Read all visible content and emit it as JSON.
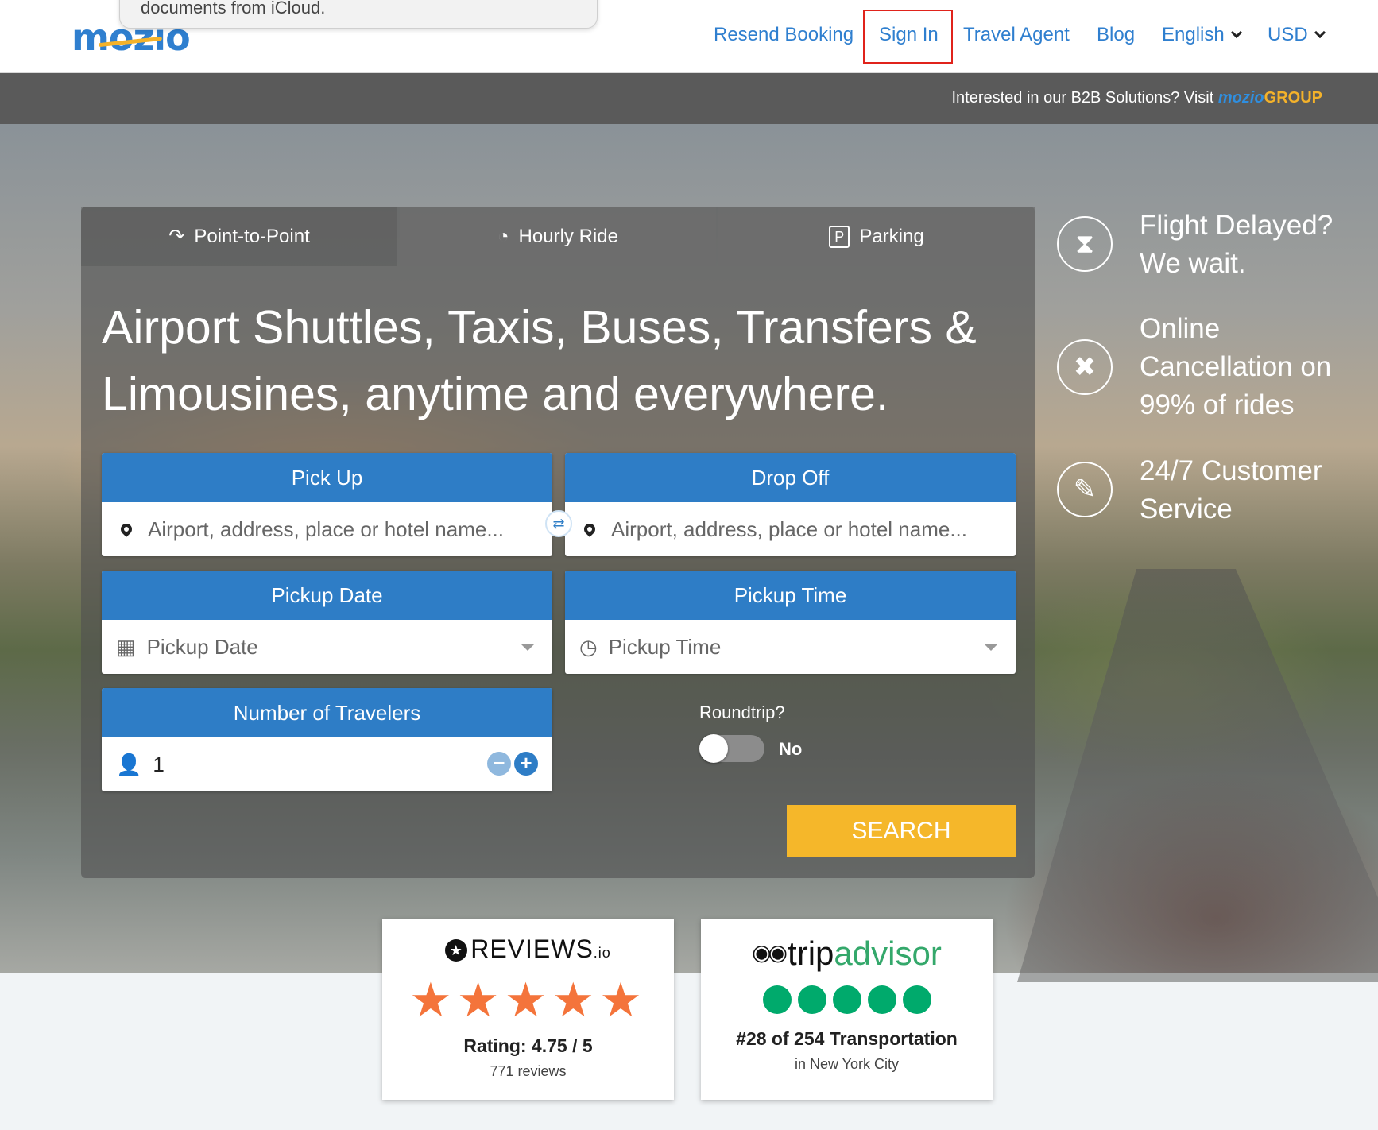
{
  "notification": {
    "text": "documents from iCloud."
  },
  "header": {
    "logo": "mozio",
    "nav": [
      "Resend Booking",
      "Sign In",
      "Travel Agent",
      "Blog"
    ],
    "language": "English",
    "currency": "USD"
  },
  "b2b": {
    "text": "Interested in our B2B Solutions? Visit ",
    "brand": "mozio",
    "group": "GROUP"
  },
  "tabs": [
    "Point-to-Point",
    "Hourly Ride",
    "Parking"
  ],
  "headline": "Airport Shuttles, Taxis, Buses, Transfers & Limousines, anytime and everywhere.",
  "form": {
    "pickup": {
      "label": "Pick Up",
      "placeholder": "Airport, address, place or hotel name..."
    },
    "dropoff": {
      "label": "Drop Off",
      "placeholder": "Airport, address, place or hotel name..."
    },
    "pickup_date": {
      "label": "Pickup Date",
      "placeholder": "Pickup Date"
    },
    "pickup_time": {
      "label": "Pickup Time",
      "placeholder": "Pickup Time"
    },
    "travelers": {
      "label": "Number of Travelers",
      "value": "1"
    },
    "roundtrip": {
      "label": "Roundtrip?",
      "value": "No"
    },
    "search_label": "SEARCH"
  },
  "features": [
    {
      "icon": "hourglass-icon",
      "text": "Flight Delayed? We wait."
    },
    {
      "icon": "cancel-icon",
      "text": "Online Cancellation on 99% of rides"
    },
    {
      "icon": "chat-icon",
      "text": "24/7 Customer Service"
    }
  ],
  "reviews_io": {
    "brand": "REVIEWS",
    "suffix": ".io",
    "rating": 4.75,
    "rating_text": "Rating: 4.75 / 5",
    "count": "771 reviews"
  },
  "tripadvisor": {
    "brand_trip": "trip",
    "brand_advisor": "advisor",
    "bubbles": 5,
    "rank": "#28 of 254 Transportation",
    "location": "in New York City"
  },
  "colors": {
    "brand_blue": "#2e7dc6",
    "search_yellow": "#f5b72a",
    "review_star": "#f4743b",
    "ta_green": "#00aa6c",
    "highlight_red": "#e0231b"
  }
}
